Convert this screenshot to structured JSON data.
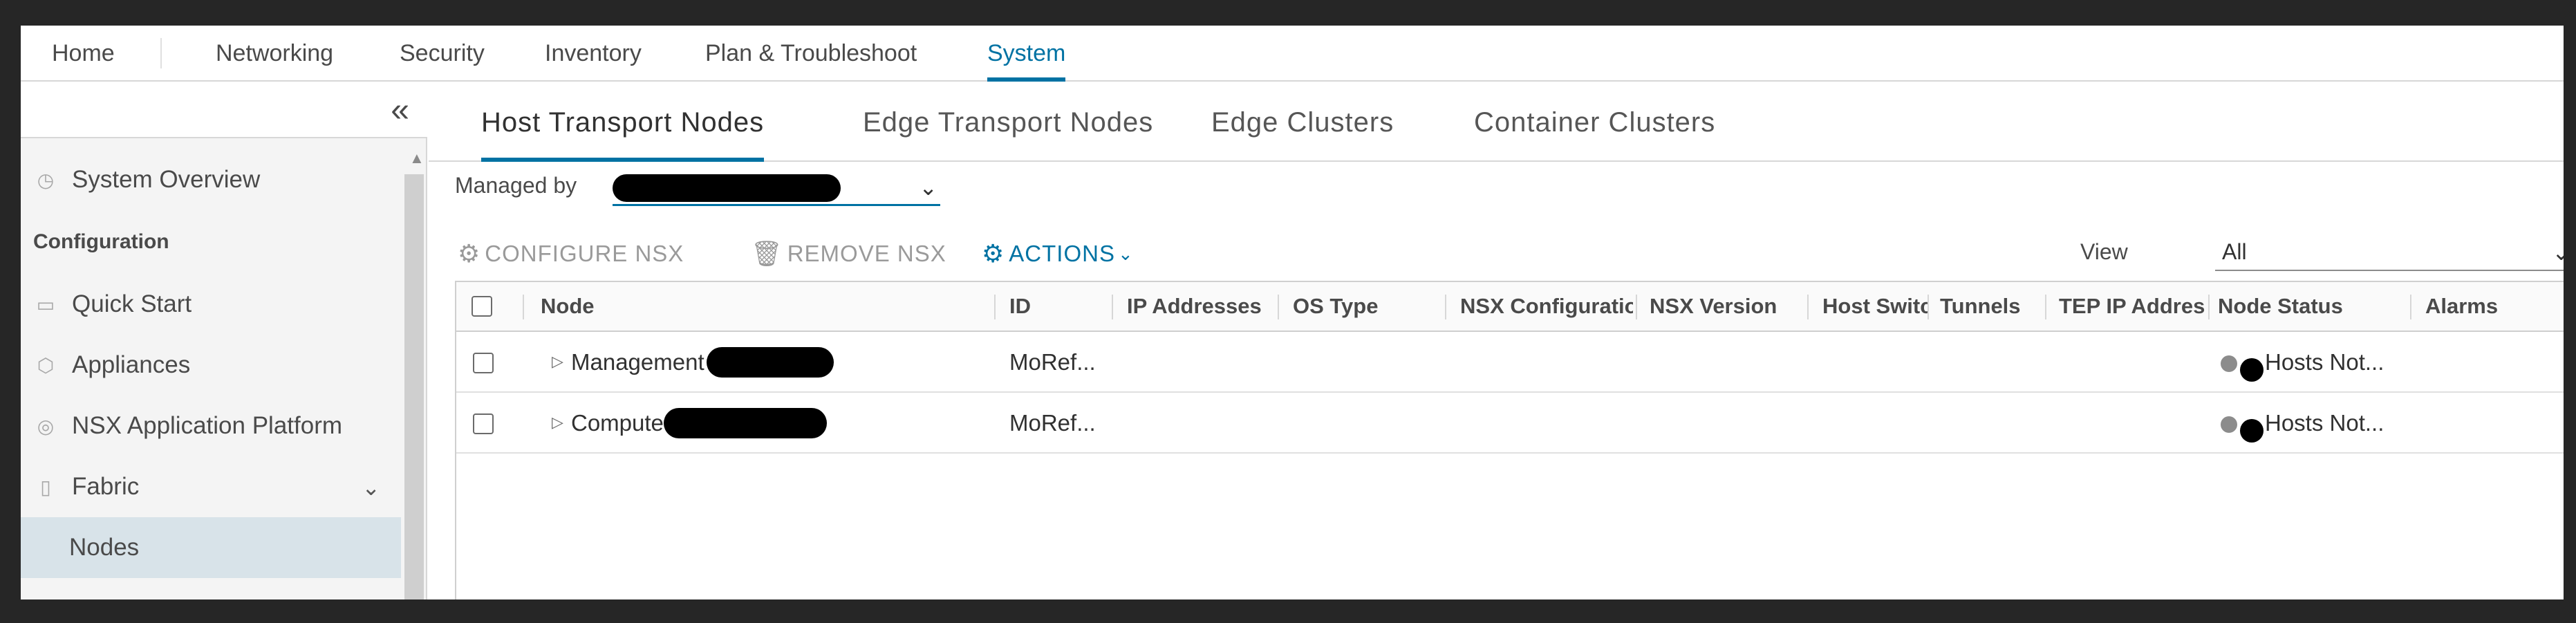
{
  "topnav": {
    "items": [
      "Home",
      "Networking",
      "Security",
      "Inventory",
      "Plan & Troubleshoot",
      "System"
    ],
    "active": "System"
  },
  "sidebar": {
    "collapse_icon": "«",
    "items": [
      {
        "label": "System Overview",
        "icon": "gauge-icon"
      },
      {
        "label": "Configuration",
        "heading": true
      },
      {
        "label": "Quick Start",
        "icon": "laptop-icon"
      },
      {
        "label": "Appliances",
        "icon": "cube-icon"
      },
      {
        "label": "NSX Application Platform",
        "icon": "circle-target-icon"
      },
      {
        "label": "Fabric",
        "icon": "phone-icon",
        "expandable": true
      },
      {
        "label": "Nodes",
        "selected": true
      }
    ]
  },
  "subtabs": [
    "Host Transport Nodes",
    "Edge Transport Nodes",
    "Edge Clusters",
    "Container Clusters"
  ],
  "managed_by": {
    "label": "Managed by",
    "value": ""
  },
  "toolbar": {
    "configure": "CONFIGURE NSX",
    "remove": "REMOVE NSX",
    "actions": "ACTIONS"
  },
  "view": {
    "label": "View",
    "value": "All"
  },
  "grid": {
    "columns": [
      "Node",
      "ID",
      "IP Addresses",
      "OS Type",
      "NSX Configuratio",
      "NSX Version",
      "Host Switc",
      "Tunnels",
      "TEP IP Addres",
      "Node Status",
      "Alarms"
    ],
    "rows": [
      {
        "node": "Management",
        "id": "MoRef...",
        "status": "Hosts Not..."
      },
      {
        "node": "Compute",
        "id": "MoRef...",
        "status": "Hosts Not..."
      }
    ]
  }
}
